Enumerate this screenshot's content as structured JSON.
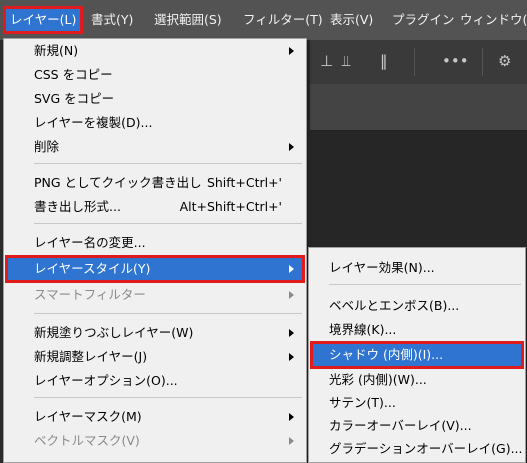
{
  "menubar": {
    "items": [
      {
        "label": "レイヤー(L)"
      },
      {
        "label": "書式(Y)"
      },
      {
        "label": "選択範囲(S)"
      },
      {
        "label": "フィルター(T)"
      },
      {
        "label": "表示(V)"
      },
      {
        "label": "プラグイン"
      },
      {
        "label": "ウィンドウ(W"
      }
    ]
  },
  "layer_menu": {
    "items": [
      {
        "label": "新規(N)"
      },
      {
        "label": "CSS をコピー"
      },
      {
        "label": "SVG をコピー"
      },
      {
        "label": "レイヤーを複製(D)..."
      },
      {
        "label": "削除"
      },
      {
        "label": "PNG としてクイック書き出し",
        "shortcut": "Shift+Ctrl+'"
      },
      {
        "label": "書き出し形式...",
        "shortcut": "Alt+Shift+Ctrl+'"
      },
      {
        "label": "レイヤー名の変更..."
      },
      {
        "label": "レイヤースタイル(Y)"
      },
      {
        "label": "スマートフィルター"
      },
      {
        "label": "新規塗りつぶしレイヤー(W)"
      },
      {
        "label": "新規調整レイヤー(J)"
      },
      {
        "label": "レイヤーオプション(O)..."
      },
      {
        "label": "レイヤーマスク(M)"
      },
      {
        "label": "ベクトルマスク(V)"
      }
    ]
  },
  "style_submenu": {
    "items": [
      {
        "label": "レイヤー効果(N)..."
      },
      {
        "label": "ベベルとエンボス(B)..."
      },
      {
        "label": "境界線(K)..."
      },
      {
        "label": "シャドウ (内側)(I)..."
      },
      {
        "label": "光彩 (内側)(W)..."
      },
      {
        "label": "サテン(T)..."
      },
      {
        "label": "カラーオーバーレイ(V)..."
      },
      {
        "label": "グラデーションオーバーレイ(G)..."
      }
    ]
  },
  "colors": {
    "highlight": "#2f74d0",
    "annotation": "#e01b1b",
    "menu_bg": "#f0f0f0"
  }
}
